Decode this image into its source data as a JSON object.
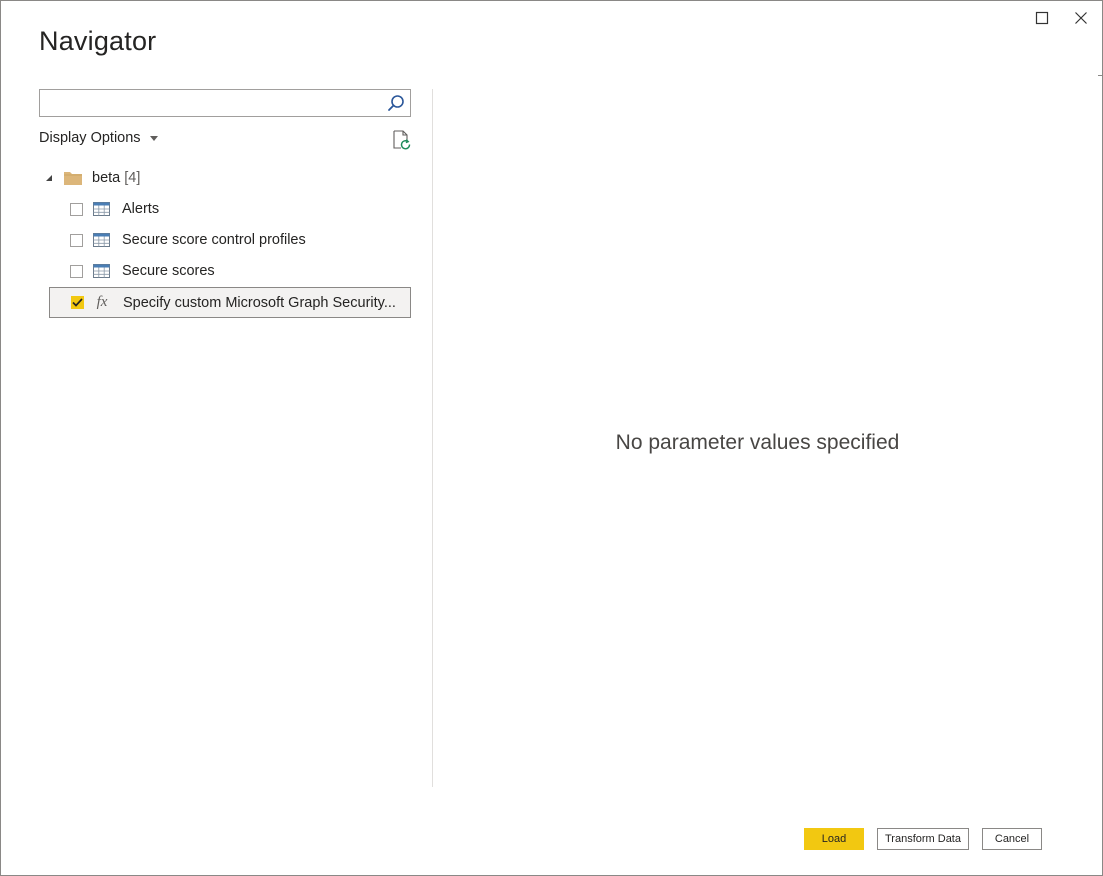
{
  "window": {
    "title": "Navigator",
    "controls": {
      "maximize_icon": "maximize-icon",
      "close_icon": "close-icon"
    }
  },
  "search": {
    "value": "",
    "placeholder": "",
    "icon": "search-icon"
  },
  "display_options": {
    "label": "Display Options",
    "icon": "chevron-down-icon"
  },
  "refresh": {
    "icon": "refresh-icon"
  },
  "tree": {
    "folder": {
      "name": "beta",
      "count": "[4]",
      "expanded": true,
      "icon": "folder-icon"
    },
    "items": [
      {
        "label": "Alerts",
        "type": "table",
        "checked": false,
        "selected": false,
        "icon": "table-icon"
      },
      {
        "label": "Secure score control profiles",
        "type": "table",
        "checked": false,
        "selected": false,
        "icon": "table-icon"
      },
      {
        "label": "Secure scores",
        "type": "table",
        "checked": false,
        "selected": false,
        "icon": "table-icon"
      },
      {
        "label": "Specify custom Microsoft Graph Security...",
        "type": "function",
        "checked": true,
        "selected": true,
        "icon": "function-icon",
        "icon_text": "fx"
      }
    ]
  },
  "preview": {
    "message": "No parameter values specified"
  },
  "buttons": {
    "load": "Load",
    "transform": "Transform Data",
    "cancel": "Cancel"
  },
  "colors": {
    "accent": "#f2c811",
    "folder": "#dcb67a",
    "table_icon": "#4a7eb5",
    "border": "#8a8886",
    "divider": "#e1dfdd"
  }
}
